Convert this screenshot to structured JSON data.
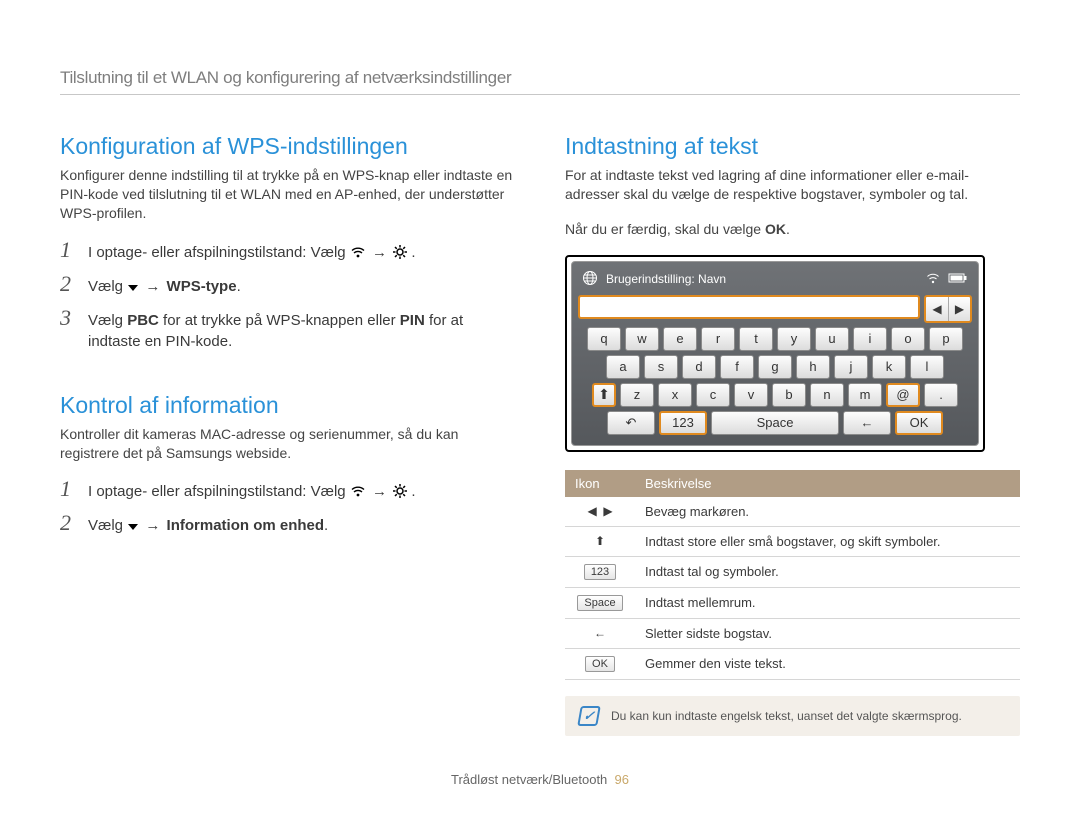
{
  "header": "Tilslutning til et WLAN og konfigurering af netværksindstillinger",
  "left": {
    "sec1": {
      "title": "Konfiguration af WPS-indstillingen",
      "intro": "Konfigurer denne indstilling til at trykke på en WPS-knap eller indtaste en PIN-kode ved tilslutning til et WLAN med en AP-enhed, der understøtter WPS-profilen.",
      "step1_pre": "I optage- eller afspilningstilstand: Vælg",
      "step2_pre": "Vælg",
      "step2_bold": "WPS-type",
      "step3_a": "Vælg ",
      "step3_b": "PBC",
      "step3_c": " for at trykke på WPS-knappen eller ",
      "step3_d": "PIN",
      "step3_e": " for at indtaste en PIN-kode."
    },
    "sec2": {
      "title": "Kontrol af information",
      "intro": "Kontroller dit kameras MAC-adresse og serienummer, så du kan registrere det på Samsungs webside.",
      "step1_pre": "I optage- eller afspilningstilstand: Vælg",
      "step2_pre": "Vælg",
      "step2_bold": "Information om enhed"
    }
  },
  "right": {
    "title": "Indtastning af tekst",
    "p1": "For at indtaste tekst ved lagring af dine informationer eller e-mail-adresser skal du vælge de respektive bogstaver, symboler og tal.",
    "p2a": "Når du er færdig, skal du vælge ",
    "p2b": "OK",
    "kbd_title": "Brugerindstilling: Navn",
    "row1": [
      "q",
      "w",
      "e",
      "r",
      "t",
      "y",
      "u",
      "i",
      "o",
      "p"
    ],
    "row2": [
      "a",
      "s",
      "d",
      "f",
      "g",
      "h",
      "j",
      "k",
      "l"
    ],
    "row3": [
      "z",
      "x",
      "c",
      "v",
      "b",
      "n",
      "m",
      "@",
      "."
    ],
    "row4_123": "123",
    "row4_space": "Space",
    "row4_ok": "OK",
    "table": {
      "h1": "Ikon",
      "h2": "Beskrivelse",
      "r1_desc": "Bevæg markøren.",
      "r2_desc": "Indtast store eller små bogstaver, og skift symboler.",
      "r3_icon": "123",
      "r3_desc": "Indtast tal og symboler.",
      "r4_icon": "Space",
      "r4_desc": "Indtast mellemrum.",
      "r5_desc": "Sletter sidste bogstav.",
      "r6_icon": "OK",
      "r6_desc": "Gemmer den viste tekst."
    },
    "note": "Du kan kun indtaste engelsk tekst, uanset det valgte skærmsprog."
  },
  "footer": {
    "section": "Trådløst netværk/Bluetooth",
    "page": "96"
  }
}
